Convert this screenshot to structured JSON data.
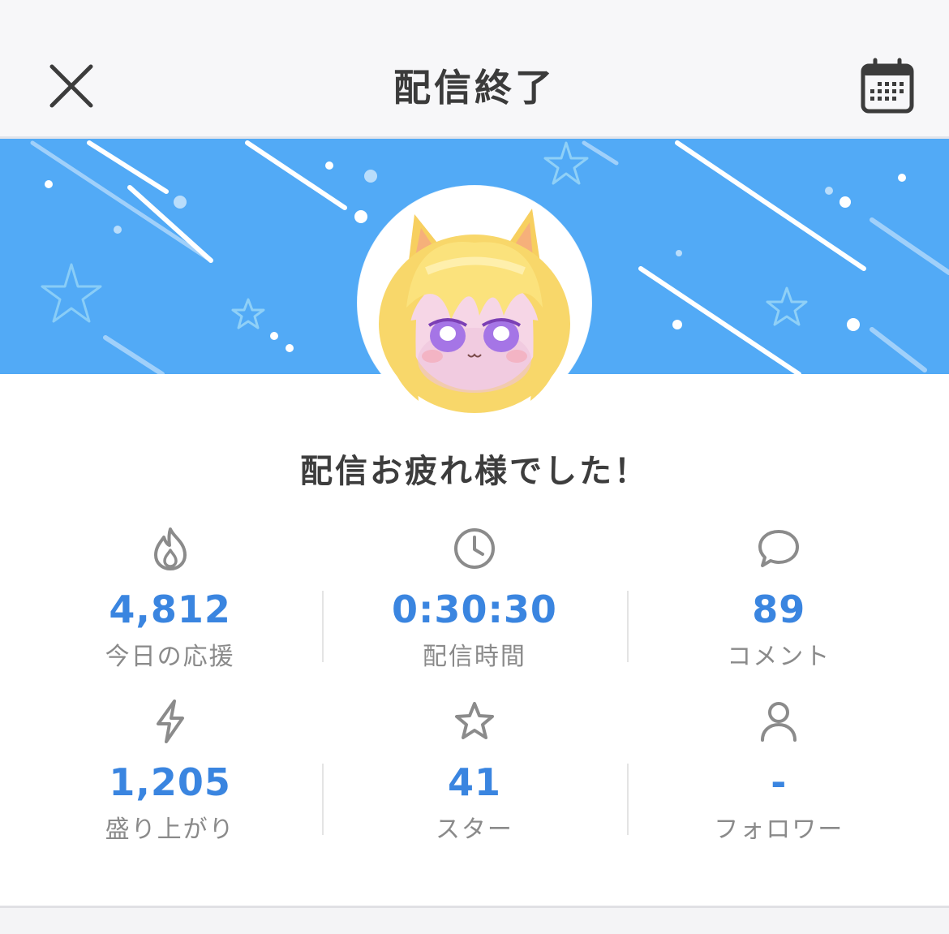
{
  "header": {
    "title": "配信終了",
    "close_icon": "close-icon",
    "calendar_icon": "calendar-icon"
  },
  "colors": {
    "banner": "#52aaf6",
    "accent": "#3a85e0",
    "label": "#8a8a8a"
  },
  "message": "配信お疲れ様でした！",
  "stats": [
    {
      "icon": "flame-icon",
      "value": "4,812",
      "label": "今日の応援"
    },
    {
      "icon": "clock-icon",
      "value": "0:30:30",
      "label": "配信時間"
    },
    {
      "icon": "comment-icon",
      "value": "89",
      "label": "コメント"
    },
    {
      "icon": "lightning-icon",
      "value": "1,205",
      "label": "盛り上がり"
    },
    {
      "icon": "star-icon",
      "value": "41",
      "label": "スター"
    },
    {
      "icon": "person-icon",
      "value": "-",
      "label": "フォロワー"
    }
  ]
}
